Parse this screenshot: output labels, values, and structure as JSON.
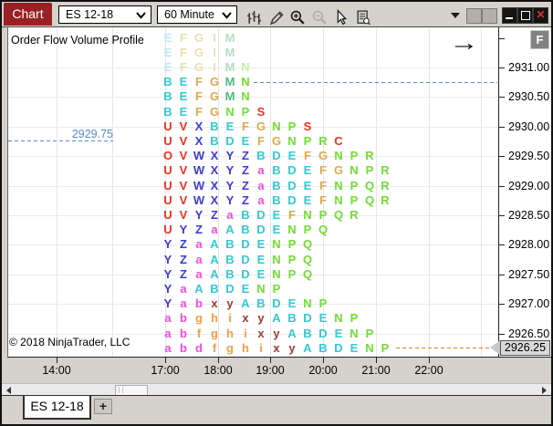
{
  "titlebar": {
    "chart_tab": "Chart",
    "instrument_dropdown": "ES 12-18",
    "interval_dropdown": "60 Minute",
    "icon_names": [
      "chart-style-icon",
      "draw-tool-icon",
      "zoom-in-icon",
      "zoom-out-icon",
      "pointer-icon",
      "data-series-icon",
      "toolbar-caret-icon",
      "link-icon",
      "link-icon",
      "minimize-icon",
      "restore-icon",
      "close-icon"
    ],
    "close_glyph": "✕"
  },
  "chart": {
    "indicator_label": "Order Flow Volume Profile",
    "copyright": "© 2018 NinjaTrader, LLC",
    "fullscreen_button": "F",
    "jump_arrow": "→",
    "left_price_label": "2929.75",
    "price_axis": {
      "labels": [
        "2931.00",
        "2930.50",
        "2930.00",
        "2929.50",
        "2929.00",
        "2928.50",
        "2928.00",
        "2927.50",
        "2927.00",
        "2926.50"
      ],
      "last_price_marker": "2926.25"
    },
    "time_axis": {
      "labels": [
        "14:00",
        "17:00",
        "18:00",
        "19:00",
        "20:00",
        "21:00",
        "22:00"
      ]
    },
    "reference_line_colors": {
      "dashed_blue": "#5B87D6",
      "dashed_orange": "#C9881A"
    },
    "profile": {
      "palette": {
        "R": "#ED3123",
        "B": "#3B3BD9",
        "M": "#F04CD4",
        "O": "#F59D3F",
        "D": "#A23B30",
        "C": "#33C9D1",
        "T": "#D9AA50",
        "G": "#4EBB7D",
        "L": "#71DC33",
        "c": "#BCE9F1",
        "t": "#EDDFAF",
        "g": "#B3DFC5",
        "l": "#C9EFA3"
      },
      "rows": [
        {
          "letters": [
            [
              "E",
              "c"
            ],
            [
              "F",
              "t"
            ],
            [
              "G",
              "t"
            ],
            [
              "I",
              "t"
            ],
            [
              "M",
              "g"
            ]
          ]
        },
        {
          "letters": [
            [
              "E",
              "c"
            ],
            [
              "F",
              "t"
            ],
            [
              "G",
              "t"
            ],
            [
              "I",
              "t"
            ],
            [
              "M",
              "g"
            ]
          ]
        },
        {
          "letters": [
            [
              "E",
              "c"
            ],
            [
              "F",
              "t"
            ],
            [
              "G",
              "t"
            ],
            [
              "I",
              "t"
            ],
            [
              "M",
              "g"
            ],
            [
              "N",
              "l"
            ]
          ]
        },
        {
          "letters": [
            [
              "B",
              "C"
            ],
            [
              "E",
              "C"
            ],
            [
              "F",
              "T"
            ],
            [
              "G",
              "T"
            ],
            [
              "M",
              "G"
            ],
            [
              "N",
              "L"
            ]
          ]
        },
        {
          "letters": [
            [
              "B",
              "C"
            ],
            [
              "E",
              "C"
            ],
            [
              "F",
              "T"
            ],
            [
              "G",
              "T"
            ],
            [
              "M",
              "G"
            ],
            [
              "N",
              "L"
            ]
          ]
        },
        {
          "letters": [
            [
              "B",
              "C"
            ],
            [
              "E",
              "C"
            ],
            [
              "F",
              "T"
            ],
            [
              "G",
              "T"
            ],
            [
              "N",
              "L"
            ],
            [
              "P",
              "L"
            ],
            [
              "S",
              "R"
            ]
          ]
        },
        {
          "letters": [
            [
              "U",
              "R"
            ],
            [
              "V",
              "R"
            ],
            [
              "X",
              "B"
            ],
            [
              "B",
              "C"
            ],
            [
              "E",
              "C"
            ],
            [
              "F",
              "T"
            ],
            [
              "G",
              "T"
            ],
            [
              "N",
              "L"
            ],
            [
              "P",
              "L"
            ],
            [
              "S",
              "R"
            ]
          ]
        },
        {
          "letters": [
            [
              "U",
              "R"
            ],
            [
              "V",
              "R"
            ],
            [
              "X",
              "B"
            ],
            [
              "B",
              "C"
            ],
            [
              "D",
              "C"
            ],
            [
              "E",
              "C"
            ],
            [
              "F",
              "T"
            ],
            [
              "G",
              "T"
            ],
            [
              "N",
              "L"
            ],
            [
              "P",
              "L"
            ],
            [
              "R",
              "L"
            ],
            [
              "C",
              "R"
            ]
          ]
        },
        {
          "letters": [
            [
              "O",
              "R"
            ],
            [
              "V",
              "R"
            ],
            [
              "W",
              "B"
            ],
            [
              "X",
              "B"
            ],
            [
              "Y",
              "B"
            ],
            [
              "Z",
              "B"
            ],
            [
              "B",
              "C"
            ],
            [
              "D",
              "C"
            ],
            [
              "E",
              "C"
            ],
            [
              "F",
              "T"
            ],
            [
              "G",
              "T"
            ],
            [
              "N",
              "L"
            ],
            [
              "P",
              "L"
            ],
            [
              "R",
              "L"
            ]
          ]
        },
        {
          "letters": [
            [
              "U",
              "R"
            ],
            [
              "V",
              "R"
            ],
            [
              "W",
              "B"
            ],
            [
              "X",
              "B"
            ],
            [
              "Y",
              "B"
            ],
            [
              "Z",
              "B"
            ],
            [
              "a",
              "M"
            ],
            [
              "B",
              "C"
            ],
            [
              "D",
              "C"
            ],
            [
              "E",
              "C"
            ],
            [
              "F",
              "T"
            ],
            [
              "G",
              "T"
            ],
            [
              "N",
              "L"
            ],
            [
              "P",
              "L"
            ],
            [
              "R",
              "L"
            ]
          ]
        },
        {
          "letters": [
            [
              "U",
              "R"
            ],
            [
              "V",
              "R"
            ],
            [
              "W",
              "B"
            ],
            [
              "X",
              "B"
            ],
            [
              "Y",
              "B"
            ],
            [
              "Z",
              "B"
            ],
            [
              "a",
              "M"
            ],
            [
              "B",
              "C"
            ],
            [
              "D",
              "C"
            ],
            [
              "E",
              "C"
            ],
            [
              "F",
              "T"
            ],
            [
              "N",
              "L"
            ],
            [
              "P",
              "L"
            ],
            [
              "Q",
              "L"
            ],
            [
              "R",
              "L"
            ]
          ]
        },
        {
          "letters": [
            [
              "U",
              "R"
            ],
            [
              "V",
              "R"
            ],
            [
              "W",
              "B"
            ],
            [
              "X",
              "B"
            ],
            [
              "Y",
              "B"
            ],
            [
              "Z",
              "B"
            ],
            [
              "a",
              "M"
            ],
            [
              "B",
              "C"
            ],
            [
              "D",
              "C"
            ],
            [
              "E",
              "C"
            ],
            [
              "F",
              "T"
            ],
            [
              "N",
              "L"
            ],
            [
              "P",
              "L"
            ],
            [
              "Q",
              "L"
            ],
            [
              "R",
              "L"
            ]
          ]
        },
        {
          "letters": [
            [
              "U",
              "R"
            ],
            [
              "V",
              "R"
            ],
            [
              "Y",
              "B"
            ],
            [
              "Z",
              "B"
            ],
            [
              "a",
              "M"
            ],
            [
              "B",
              "C"
            ],
            [
              "D",
              "C"
            ],
            [
              "E",
              "C"
            ],
            [
              "F",
              "T"
            ],
            [
              "N",
              "L"
            ],
            [
              "P",
              "L"
            ],
            [
              "Q",
              "L"
            ],
            [
              "R",
              "L"
            ]
          ]
        },
        {
          "letters": [
            [
              "U",
              "R"
            ],
            [
              "Y",
              "B"
            ],
            [
              "Z",
              "B"
            ],
            [
              "a",
              "M"
            ],
            [
              "A",
              "C"
            ],
            [
              "B",
              "C"
            ],
            [
              "D",
              "C"
            ],
            [
              "E",
              "C"
            ],
            [
              "N",
              "L"
            ],
            [
              "P",
              "L"
            ],
            [
              "Q",
              "L"
            ]
          ]
        },
        {
          "letters": [
            [
              "Y",
              "B"
            ],
            [
              "Z",
              "B"
            ],
            [
              "a",
              "M"
            ],
            [
              "A",
              "C"
            ],
            [
              "B",
              "C"
            ],
            [
              "D",
              "C"
            ],
            [
              "E",
              "C"
            ],
            [
              "N",
              "L"
            ],
            [
              "P",
              "L"
            ],
            [
              "Q",
              "L"
            ]
          ]
        },
        {
          "letters": [
            [
              "Y",
              "B"
            ],
            [
              "Z",
              "B"
            ],
            [
              "a",
              "M"
            ],
            [
              "A",
              "C"
            ],
            [
              "B",
              "C"
            ],
            [
              "D",
              "C"
            ],
            [
              "E",
              "C"
            ],
            [
              "N",
              "L"
            ],
            [
              "P",
              "L"
            ],
            [
              "Q",
              "L"
            ]
          ]
        },
        {
          "letters": [
            [
              "Y",
              "B"
            ],
            [
              "Z",
              "B"
            ],
            [
              "a",
              "M"
            ],
            [
              "A",
              "C"
            ],
            [
              "B",
              "C"
            ],
            [
              "D",
              "C"
            ],
            [
              "E",
              "C"
            ],
            [
              "N",
              "L"
            ],
            [
              "P",
              "L"
            ],
            [
              "Q",
              "L"
            ]
          ]
        },
        {
          "letters": [
            [
              "Y",
              "B"
            ],
            [
              "a",
              "M"
            ],
            [
              "A",
              "C"
            ],
            [
              "B",
              "C"
            ],
            [
              "D",
              "C"
            ],
            [
              "E",
              "C"
            ],
            [
              "N",
              "L"
            ],
            [
              "P",
              "L"
            ]
          ]
        },
        {
          "letters": [
            [
              "Y",
              "B"
            ],
            [
              "a",
              "M"
            ],
            [
              "b",
              "M"
            ],
            [
              "x",
              "D"
            ],
            [
              "y",
              "D"
            ],
            [
              "A",
              "C"
            ],
            [
              "B",
              "C"
            ],
            [
              "D",
              "C"
            ],
            [
              "E",
              "C"
            ],
            [
              "N",
              "L"
            ],
            [
              "P",
              "L"
            ]
          ]
        },
        {
          "letters": [
            [
              "a",
              "M"
            ],
            [
              "b",
              "M"
            ],
            [
              "g",
              "O"
            ],
            [
              "h",
              "O"
            ],
            [
              "i",
              "O"
            ],
            [
              "x",
              "D"
            ],
            [
              "y",
              "D"
            ],
            [
              "A",
              "C"
            ],
            [
              "B",
              "C"
            ],
            [
              "D",
              "C"
            ],
            [
              "E",
              "C"
            ],
            [
              "N",
              "L"
            ],
            [
              "P",
              "L"
            ]
          ]
        },
        {
          "letters": [
            [
              "a",
              "M"
            ],
            [
              "b",
              "M"
            ],
            [
              "f",
              "O"
            ],
            [
              "g",
              "O"
            ],
            [
              "h",
              "O"
            ],
            [
              "i",
              "O"
            ],
            [
              "x",
              "D"
            ],
            [
              "y",
              "D"
            ],
            [
              "A",
              "C"
            ],
            [
              "B",
              "C"
            ],
            [
              "D",
              "C"
            ],
            [
              "E",
              "C"
            ],
            [
              "N",
              "L"
            ],
            [
              "P",
              "L"
            ]
          ]
        },
        {
          "letters": [
            [
              "a",
              "M"
            ],
            [
              "b",
              "M"
            ],
            [
              "d",
              "M"
            ],
            [
              "f",
              "O"
            ],
            [
              "g",
              "O"
            ],
            [
              "h",
              "O"
            ],
            [
              "i",
              "O"
            ],
            [
              "x",
              "D"
            ],
            [
              "y",
              "D"
            ],
            [
              "A",
              "C"
            ],
            [
              "B",
              "C"
            ],
            [
              "D",
              "C"
            ],
            [
              "E",
              "C"
            ],
            [
              "N",
              "L"
            ],
            [
              "P",
              "L"
            ]
          ]
        }
      ]
    }
  },
  "workspace_tabs": {
    "active_tab": "ES 12-18",
    "add_button": "+"
  },
  "colors": {
    "accent_red": "#9B2023",
    "titlebar_bg": "#D5D2CB",
    "marker_bg": "#D9D9D9"
  }
}
